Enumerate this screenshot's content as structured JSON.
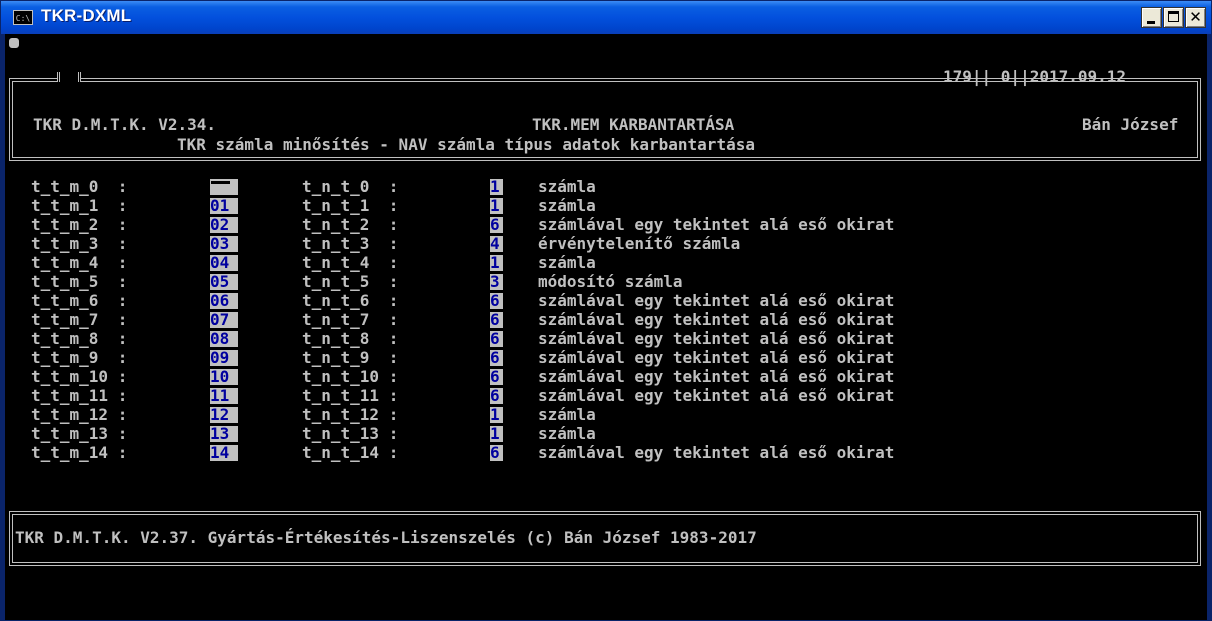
{
  "window": {
    "title": "TKR-DXML",
    "icon_label": "C:\\",
    "controls": [
      "minimize-icon",
      "maximize-icon",
      "close-icon"
    ]
  },
  "header": {
    "top_right": "179|| 0||2017.09.12",
    "left": "TKR D.M.T.K. V2.34.",
    "center": "TKR.MEM KARBANTARTÁSA",
    "right": "Bán József",
    "subtitle": "TKR számla minősítés - NAV számla típus adatok karbantartása"
  },
  "rows": [
    {
      "label": "t_t_m_0  :",
      "value": "",
      "label2": "t_n_t_0  :",
      "code": "1",
      "desc": "számla"
    },
    {
      "label": "t_t_m_1  :",
      "value": "01",
      "label2": "t_n_t_1  :",
      "code": "1",
      "desc": "számla"
    },
    {
      "label": "t_t_m_2  :",
      "value": "02",
      "label2": "t_n_t_2  :",
      "code": "6",
      "desc": "számlával egy tekintet alá eső okirat"
    },
    {
      "label": "t_t_m_3  :",
      "value": "03",
      "label2": "t_n_t_3  :",
      "code": "4",
      "desc": "érvénytelenítő számla"
    },
    {
      "label": "t_t_m_4  :",
      "value": "04",
      "label2": "t_n_t_4  :",
      "code": "1",
      "desc": "számla"
    },
    {
      "label": "t_t_m_5  :",
      "value": "05",
      "label2": "t_n_t_5  :",
      "code": "3",
      "desc": "módosító számla"
    },
    {
      "label": "t_t_m_6  :",
      "value": "06",
      "label2": "t_n_t_6  :",
      "code": "6",
      "desc": "számlával egy tekintet alá eső okirat"
    },
    {
      "label": "t_t_m_7  :",
      "value": "07",
      "label2": "t_n_t_7  :",
      "code": "6",
      "desc": "számlával egy tekintet alá eső okirat"
    },
    {
      "label": "t_t_m_8  :",
      "value": "08",
      "label2": "t_n_t_8  :",
      "code": "6",
      "desc": "számlával egy tekintet alá eső okirat"
    },
    {
      "label": "t_t_m_9  :",
      "value": "09",
      "label2": "t_n_t_9  :",
      "code": "6",
      "desc": "számlával egy tekintet alá eső okirat"
    },
    {
      "label": "t_t_m_10 :",
      "value": "10",
      "label2": "t_n_t_10 :",
      "code": "6",
      "desc": "számlával egy tekintet alá eső okirat"
    },
    {
      "label": "t_t_m_11 :",
      "value": "11",
      "label2": "t_n_t_11 :",
      "code": "6",
      "desc": "számlával egy tekintet alá eső okirat"
    },
    {
      "label": "t_t_m_12 :",
      "value": "12",
      "label2": "t_n_t_12 :",
      "code": "1",
      "desc": "számla"
    },
    {
      "label": "t_t_m_13 :",
      "value": "13",
      "label2": "t_n_t_13 :",
      "code": "1",
      "desc": "számla"
    },
    {
      "label": "t_t_m_14 :",
      "value": "14",
      "label2": "t_n_t_14 :",
      "code": "6",
      "desc": "számlával egy tekintet alá eső okirat"
    }
  ],
  "footer": "TKR D.M.T.K. V2.37. Gyártás-Értékesítés-Liszenszelés (c) Bán József 1983-2017",
  "colors": {
    "titlebar": "#0054e3",
    "console_bg": "#000000",
    "console_fg": "#c0c0c0",
    "field_bg": "#c0c0c0",
    "field_fg": "#00009f"
  }
}
